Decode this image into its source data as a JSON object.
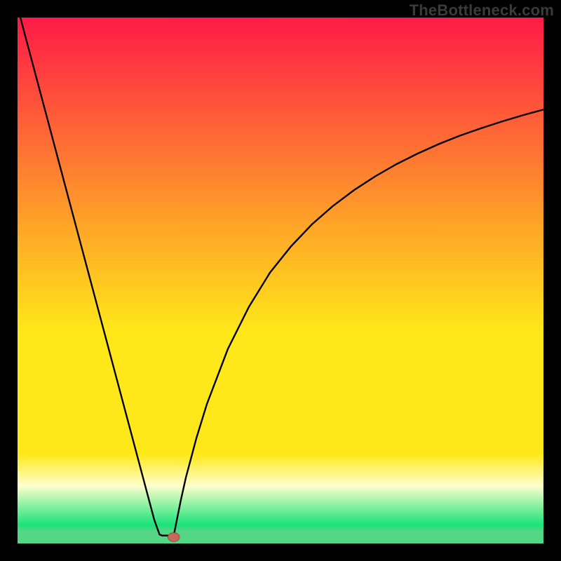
{
  "watermark": "TheBottleneck.com",
  "colors": {
    "frame": "#000000",
    "curve": "#000000",
    "marker_fill": "#c46a5c",
    "marker_stroke": "#9a4a3f",
    "gradient_top": "#ff1a47",
    "gradient_mid1": "#ffa627",
    "gradient_mid2": "#ffe81a",
    "gradient_mid3": "#ffffcc",
    "gradient_bottom_accent": "#19e37a",
    "gradient_floor": "#53d686"
  },
  "chart_data": {
    "type": "line",
    "title": "",
    "xlabel": "",
    "ylabel": "",
    "xlim": [
      0,
      100
    ],
    "ylim": [
      0,
      100
    ],
    "series": [
      {
        "name": "curve",
        "x": [
          0,
          2,
          4,
          6,
          8,
          10,
          12,
          14,
          16,
          18,
          20,
          22,
          24,
          26,
          27,
          27.5,
          28,
          28.5,
          29,
          29.7,
          30,
          30.5,
          31,
          32,
          34,
          36,
          40,
          44,
          48,
          52,
          56,
          60,
          64,
          68,
          72,
          76,
          80,
          84,
          88,
          92,
          96,
          100
        ],
        "y": [
          102,
          94.5,
          87,
          79.5,
          72,
          64.5,
          57,
          49.5,
          42,
          34.5,
          27,
          19.5,
          12,
          4.5,
          1.7,
          1.5,
          1.5,
          1.5,
          1.5,
          1.5,
          3,
          5.5,
          8,
          12.5,
          20,
          26.5,
          37,
          45,
          51.5,
          56.5,
          60.7,
          64.2,
          67.2,
          69.8,
          72.1,
          74.1,
          75.9,
          77.5,
          78.9,
          80.2,
          81.4,
          82.5
        ]
      }
    ],
    "marker": {
      "x": 29.7,
      "y": 1.2,
      "rx": 1.1,
      "ry": 0.85
    },
    "gradient_stops": [
      {
        "offset": 0.0,
        "color": "#ff1a47"
      },
      {
        "offset": 0.4,
        "color": "#ffa627"
      },
      {
        "offset": 0.6,
        "color": "#ffe81a"
      },
      {
        "offset": 0.83,
        "color": "#ffe81a"
      },
      {
        "offset": 0.89,
        "color": "#ffffcc"
      },
      {
        "offset": 0.965,
        "color": "#19e37a"
      },
      {
        "offset": 0.975,
        "color": "#53d686"
      },
      {
        "offset": 1.0,
        "color": "#53d686"
      }
    ]
  }
}
